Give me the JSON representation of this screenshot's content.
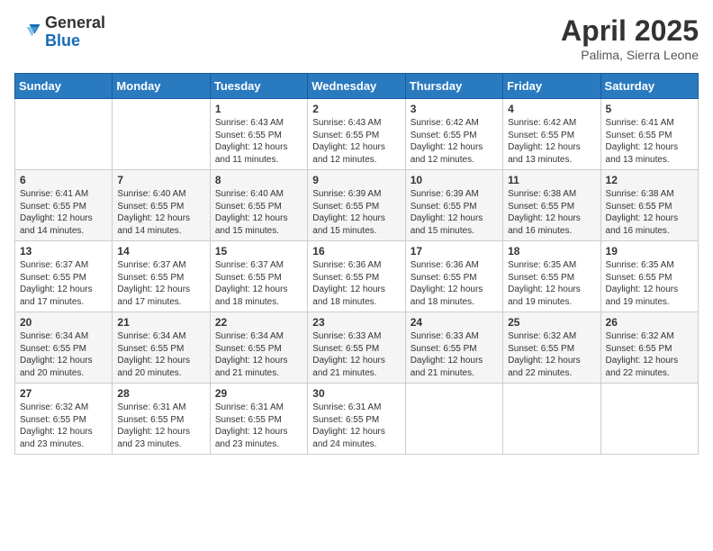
{
  "header": {
    "logo_general": "General",
    "logo_blue": "Blue",
    "month_title": "April 2025",
    "location": "Palima, Sierra Leone"
  },
  "days_of_week": [
    "Sunday",
    "Monday",
    "Tuesday",
    "Wednesday",
    "Thursday",
    "Friday",
    "Saturday"
  ],
  "weeks": [
    [
      {
        "day": "",
        "info": ""
      },
      {
        "day": "",
        "info": ""
      },
      {
        "day": "1",
        "info": "Sunrise: 6:43 AM\nSunset: 6:55 PM\nDaylight: 12 hours and 11 minutes."
      },
      {
        "day": "2",
        "info": "Sunrise: 6:43 AM\nSunset: 6:55 PM\nDaylight: 12 hours and 12 minutes."
      },
      {
        "day": "3",
        "info": "Sunrise: 6:42 AM\nSunset: 6:55 PM\nDaylight: 12 hours and 12 minutes."
      },
      {
        "day": "4",
        "info": "Sunrise: 6:42 AM\nSunset: 6:55 PM\nDaylight: 12 hours and 13 minutes."
      },
      {
        "day": "5",
        "info": "Sunrise: 6:41 AM\nSunset: 6:55 PM\nDaylight: 12 hours and 13 minutes."
      }
    ],
    [
      {
        "day": "6",
        "info": "Sunrise: 6:41 AM\nSunset: 6:55 PM\nDaylight: 12 hours and 14 minutes."
      },
      {
        "day": "7",
        "info": "Sunrise: 6:40 AM\nSunset: 6:55 PM\nDaylight: 12 hours and 14 minutes."
      },
      {
        "day": "8",
        "info": "Sunrise: 6:40 AM\nSunset: 6:55 PM\nDaylight: 12 hours and 15 minutes."
      },
      {
        "day": "9",
        "info": "Sunrise: 6:39 AM\nSunset: 6:55 PM\nDaylight: 12 hours and 15 minutes."
      },
      {
        "day": "10",
        "info": "Sunrise: 6:39 AM\nSunset: 6:55 PM\nDaylight: 12 hours and 15 minutes."
      },
      {
        "day": "11",
        "info": "Sunrise: 6:38 AM\nSunset: 6:55 PM\nDaylight: 12 hours and 16 minutes."
      },
      {
        "day": "12",
        "info": "Sunrise: 6:38 AM\nSunset: 6:55 PM\nDaylight: 12 hours and 16 minutes."
      }
    ],
    [
      {
        "day": "13",
        "info": "Sunrise: 6:37 AM\nSunset: 6:55 PM\nDaylight: 12 hours and 17 minutes."
      },
      {
        "day": "14",
        "info": "Sunrise: 6:37 AM\nSunset: 6:55 PM\nDaylight: 12 hours and 17 minutes."
      },
      {
        "day": "15",
        "info": "Sunrise: 6:37 AM\nSunset: 6:55 PM\nDaylight: 12 hours and 18 minutes."
      },
      {
        "day": "16",
        "info": "Sunrise: 6:36 AM\nSunset: 6:55 PM\nDaylight: 12 hours and 18 minutes."
      },
      {
        "day": "17",
        "info": "Sunrise: 6:36 AM\nSunset: 6:55 PM\nDaylight: 12 hours and 18 minutes."
      },
      {
        "day": "18",
        "info": "Sunrise: 6:35 AM\nSunset: 6:55 PM\nDaylight: 12 hours and 19 minutes."
      },
      {
        "day": "19",
        "info": "Sunrise: 6:35 AM\nSunset: 6:55 PM\nDaylight: 12 hours and 19 minutes."
      }
    ],
    [
      {
        "day": "20",
        "info": "Sunrise: 6:34 AM\nSunset: 6:55 PM\nDaylight: 12 hours and 20 minutes."
      },
      {
        "day": "21",
        "info": "Sunrise: 6:34 AM\nSunset: 6:55 PM\nDaylight: 12 hours and 20 minutes."
      },
      {
        "day": "22",
        "info": "Sunrise: 6:34 AM\nSunset: 6:55 PM\nDaylight: 12 hours and 21 minutes."
      },
      {
        "day": "23",
        "info": "Sunrise: 6:33 AM\nSunset: 6:55 PM\nDaylight: 12 hours and 21 minutes."
      },
      {
        "day": "24",
        "info": "Sunrise: 6:33 AM\nSunset: 6:55 PM\nDaylight: 12 hours and 21 minutes."
      },
      {
        "day": "25",
        "info": "Sunrise: 6:32 AM\nSunset: 6:55 PM\nDaylight: 12 hours and 22 minutes."
      },
      {
        "day": "26",
        "info": "Sunrise: 6:32 AM\nSunset: 6:55 PM\nDaylight: 12 hours and 22 minutes."
      }
    ],
    [
      {
        "day": "27",
        "info": "Sunrise: 6:32 AM\nSunset: 6:55 PM\nDaylight: 12 hours and 23 minutes."
      },
      {
        "day": "28",
        "info": "Sunrise: 6:31 AM\nSunset: 6:55 PM\nDaylight: 12 hours and 23 minutes."
      },
      {
        "day": "29",
        "info": "Sunrise: 6:31 AM\nSunset: 6:55 PM\nDaylight: 12 hours and 23 minutes."
      },
      {
        "day": "30",
        "info": "Sunrise: 6:31 AM\nSunset: 6:55 PM\nDaylight: 12 hours and 24 minutes."
      },
      {
        "day": "",
        "info": ""
      },
      {
        "day": "",
        "info": ""
      },
      {
        "day": "",
        "info": ""
      }
    ]
  ]
}
